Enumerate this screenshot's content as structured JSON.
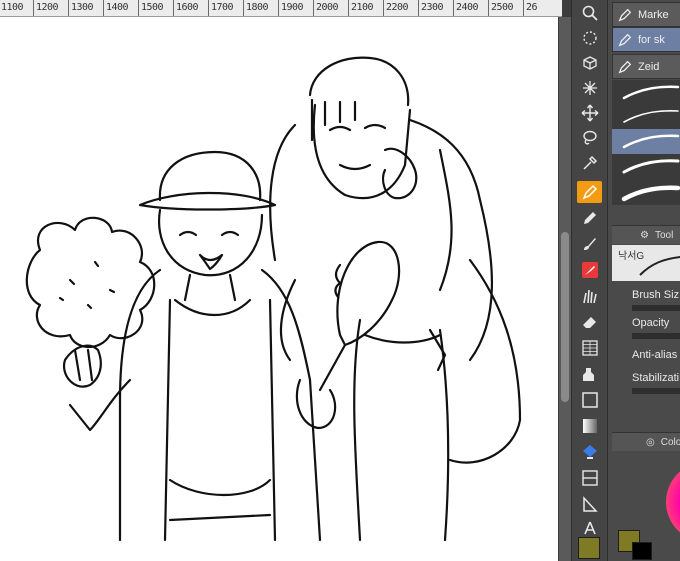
{
  "ruler": {
    "ticks": [
      "1100",
      "1200",
      "1300",
      "1400",
      "1500",
      "1600",
      "1700",
      "1800",
      "1900",
      "2000",
      "2100",
      "2200",
      "2300",
      "2400",
      "2500",
      "26"
    ]
  },
  "panel": {
    "sub_tools": [
      "Marke",
      "for sk",
      "Zeid"
    ],
    "tool_property_tab": "Tool",
    "brush_preview_label": "낙서G",
    "properties": {
      "brush_size": "Brush Siz",
      "opacity": "Opacity",
      "anti_alias": "Anti-alias",
      "stabilization": "Stabilizati"
    },
    "color_tab": "Colo"
  },
  "colors": {
    "active_tool": "#f39c12",
    "main_color": "#7f7a24",
    "sub_color": "#000000"
  },
  "icons": [
    "zoom-icon",
    "rotate-icon",
    "object-icon",
    "auto-select-icon",
    "move-icon",
    "lasso-icon",
    "eyedropper-icon",
    "pen-icon",
    "pencil-icon",
    "brush-icon",
    "airbrush-icon",
    "decoration-icon",
    "eraser-icon",
    "blend-icon",
    "fill-icon",
    "gradient-icon",
    "figure-icon",
    "frame-icon",
    "ruler-icon",
    "text-icon"
  ]
}
